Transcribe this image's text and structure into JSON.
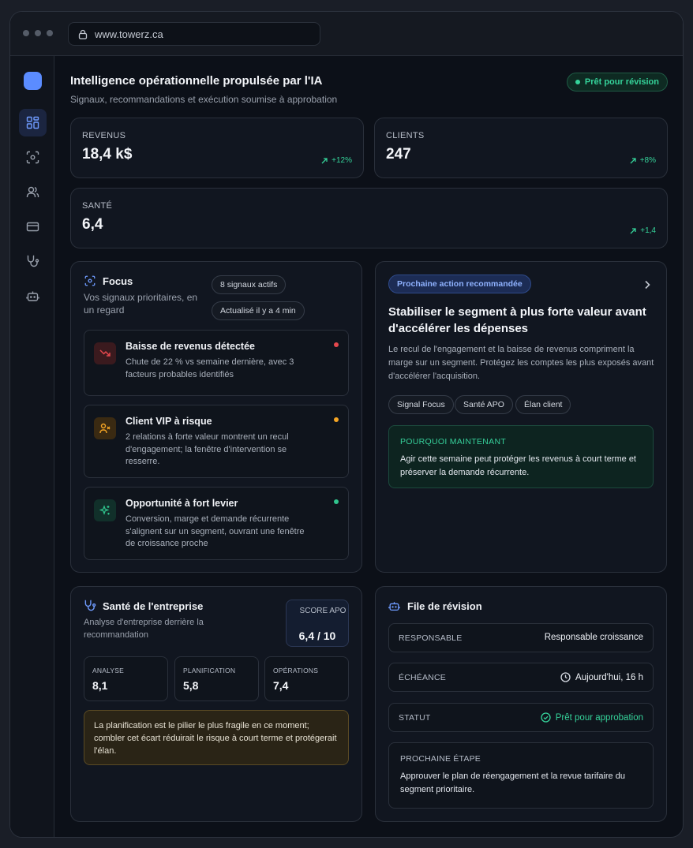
{
  "browser": {
    "url": "www.towerz.ca"
  },
  "header": {
    "title": "Intelligence opérationnelle propulsée par l'IA",
    "subtitle": "Signaux, recommandations et exécution soumise à approbation",
    "status": "Prêt pour révision"
  },
  "sidebar": {
    "items": [
      {
        "icon": "dashboard-icon",
        "active": true
      },
      {
        "icon": "focus-scan-icon"
      },
      {
        "icon": "users-icon"
      },
      {
        "icon": "credit-card-icon"
      },
      {
        "icon": "stethoscope-icon"
      },
      {
        "icon": "bot-icon"
      }
    ]
  },
  "kpis": [
    {
      "label": "REVENUS",
      "value": "18,4 k$",
      "delta": "+12%"
    },
    {
      "label": "CLIENTS",
      "value": "247",
      "delta": "+8%"
    },
    {
      "label": "SANTÉ",
      "value": "6,4",
      "delta": "+1,4"
    }
  ],
  "focus": {
    "title": "Focus",
    "subtitle": "Vos signaux prioritaires, en un regard",
    "chip_signals": "8 signaux actifs",
    "chip_updated": "Actualisé il y a 4 min",
    "signals": [
      {
        "title": "Baisse de revenus détectée",
        "desc": "Chute de 22 % vs semaine dernière, avec 3 facteurs probables identifiés",
        "color": "#e5484d"
      },
      {
        "title": "Client VIP à risque",
        "desc": "2 relations à forte valeur montrent un recul d'engagement; la fenêtre d'intervention se resserre.",
        "color": "#f5a524"
      },
      {
        "title": "Opportunité à fort levier",
        "desc": "Conversion, marge et demande récurrente s'alignent sur un segment, ouvrant une fenêtre de croissance proche",
        "color": "#30c48d"
      }
    ]
  },
  "recommendation": {
    "pill": "Prochaine action recommandée",
    "title": "Stabiliser le segment à plus forte valeur avant d'accélérer les dépenses",
    "desc": "Le recul de l'engagement et la baisse de revenus compriment la marge sur un segment. Protégez les comptes les plus exposés avant d'accélérer l'acquisition.",
    "tags": [
      "Signal Focus",
      "Santé APO",
      "Élan client"
    ],
    "why_label": "POURQUOI MAINTENANT",
    "why_text": "Agir cette semaine peut protéger les revenus à court terme et préserver la demande récurrente."
  },
  "health": {
    "title": "Santé de l'entreprise",
    "subtitle": "Analyse d'entreprise derrière la recommandation",
    "score_label": "SCORE APO",
    "score_value": "6,4 / 10",
    "metrics": [
      {
        "label": "ANALYSE",
        "value": "8,1"
      },
      {
        "label": "PLANIFICATION",
        "value": "5,8"
      },
      {
        "label": "OPÉRATIONS",
        "value": "7,4"
      }
    ],
    "warning": "La planification est le pilier le plus fragile en ce moment; combler cet écart réduirait le risque à court terme et protégerait l'élan."
  },
  "review": {
    "title": "File de révision",
    "owner_label": "RESPONSABLE",
    "owner_value": "Responsable croissance",
    "due_label": "ÉCHÉANCE",
    "due_value": "Aujourd'hui, 16 h",
    "status_label": "STATUT",
    "status_value": "Prêt pour approbation",
    "next_label": "PROCHAINE ÉTAPE",
    "next_text": "Approuver le plan de réengagement et la revue tarifaire du segment prioritaire."
  },
  "colors": {
    "accent": "#5b8cff",
    "success": "#35d39a",
    "danger": "#e5484d",
    "warning": "#f5a524"
  }
}
